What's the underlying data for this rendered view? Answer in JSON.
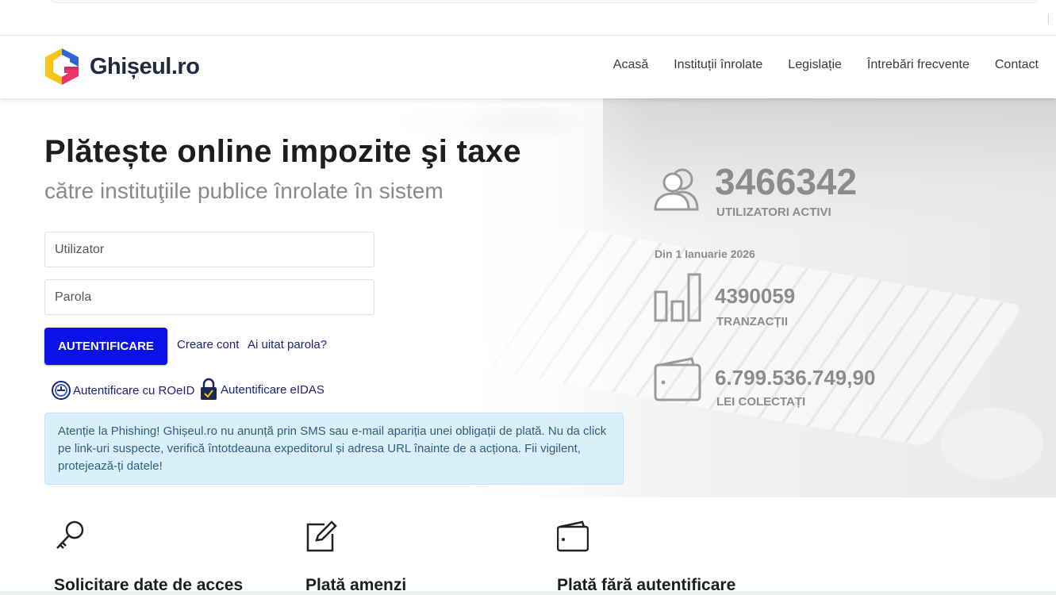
{
  "brand": {
    "name": "Ghișeul.ro"
  },
  "nav": {
    "items": [
      "Acasă",
      "Instituții înrolate",
      "Legislație",
      "Întrebări frecvente",
      "Contact"
    ]
  },
  "hero": {
    "title": "Plătește online impozite şi taxe",
    "subtitle": "către instituţiile publice înrolate în sistem"
  },
  "login": {
    "username_placeholder": "Utilizator",
    "password_placeholder": "Parola",
    "submit_label": "AUTENTIFICARE",
    "create_account": "Creare cont",
    "forgot_password": "Ai uitat parola?",
    "roeid_label": "Autentificare cu ROeID",
    "eidas_label": "Autentificare eIDAS"
  },
  "alert": {
    "text": "Atenție la Phishing! Ghișeul.ro nu anunță prin SMS sau e-mail apariția unei obligații de plată. Nu da click pe link-uri suspecte, verifică întotdeauna expeditorul și adresa URL înainte de a acționa. Fii vigilent, protejează-ți datele!"
  },
  "stats": {
    "users_count": "3466342",
    "users_label": "UTILIZATORI ACTIVI",
    "since_label": "Din 1 Ianuarie 2026",
    "transactions_count": "4390059",
    "transactions_label": "TRANZACȚII",
    "collected_amount": "6.799.536.749,90",
    "collected_label": "LEI COLECTAȚI"
  },
  "services": [
    {
      "title": "Solicitare date de acces",
      "icon": "key-icon"
    },
    {
      "title": "Plată amenzi",
      "icon": "edit-icon"
    },
    {
      "title": "Plată fără autentificare",
      "icon": "wallet-icon"
    }
  ],
  "colors": {
    "primary_button": "#0a12e8",
    "link": "#1a237e",
    "alert_bg": "#d9f0fb",
    "stat_gray": "#8c8c8c",
    "logo_blue": "#2f63d6",
    "logo_yellow": "#f5c518",
    "logo_red": "#e8336b"
  }
}
